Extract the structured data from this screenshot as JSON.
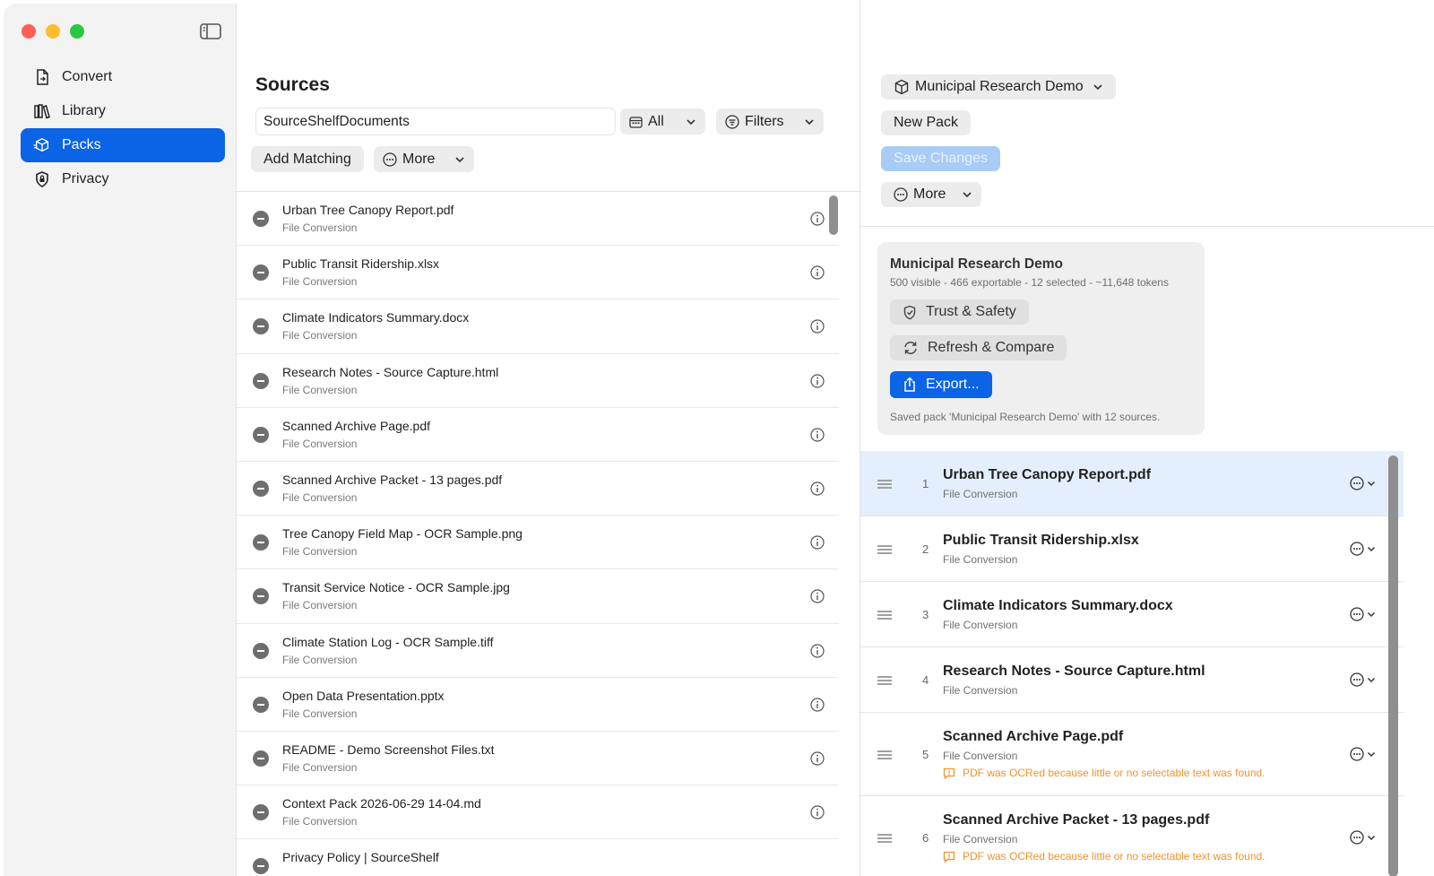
{
  "sidebar": {
    "items": [
      {
        "label": "Convert",
        "icon": "doc-convert-icon"
      },
      {
        "label": "Library",
        "icon": "books-icon"
      },
      {
        "label": "Packs",
        "icon": "cube-icon",
        "active": true
      },
      {
        "label": "Privacy",
        "icon": "shield-lock-icon"
      }
    ]
  },
  "sources": {
    "title": "Sources",
    "search_value": "SourceShelfDocuments",
    "filter_all_label": "All",
    "filters_label": "Filters",
    "add_matching_label": "Add Matching",
    "more_label": "More",
    "items": [
      {
        "name": "Urban Tree Canopy Report.pdf",
        "sub": "File Conversion"
      },
      {
        "name": "Public Transit Ridership.xlsx",
        "sub": "File Conversion"
      },
      {
        "name": "Climate Indicators Summary.docx",
        "sub": "File Conversion"
      },
      {
        "name": "Research Notes - Source Capture.html",
        "sub": "File Conversion"
      },
      {
        "name": "Scanned Archive Page.pdf",
        "sub": "File Conversion"
      },
      {
        "name": "Scanned Archive Packet - 13 pages.pdf",
        "sub": "File Conversion"
      },
      {
        "name": "Tree Canopy Field Map - OCR Sample.png",
        "sub": "File Conversion"
      },
      {
        "name": "Transit Service Notice - OCR Sample.jpg",
        "sub": "File Conversion"
      },
      {
        "name": "Climate Station Log - OCR Sample.tiff",
        "sub": "File Conversion"
      },
      {
        "name": "Open Data Presentation.pptx",
        "sub": "File Conversion"
      },
      {
        "name": "README - Demo Screenshot Files.txt",
        "sub": "File Conversion"
      },
      {
        "name": "Context Pack 2026-06-29 14-04.md",
        "sub": "File Conversion"
      },
      {
        "name": "Privacy Policy | SourceShelf",
        "sub": ""
      }
    ]
  },
  "pack": {
    "selector_label": "Municipal Research Demo",
    "new_pack_label": "New Pack",
    "save_changes_label": "Save Changes",
    "more_label": "More",
    "card": {
      "title": "Municipal Research Demo",
      "subtitle": "500 visible - 466 exportable - 12 selected - ~11,648 tokens",
      "trust_label": "Trust & Safety",
      "refresh_label": "Refresh & Compare",
      "export_label": "Export...",
      "note": "Saved pack 'Municipal Research Demo' with 12 sources."
    },
    "items": [
      {
        "index": "1",
        "title": "Urban Tree Canopy Report.pdf",
        "sub": "File Conversion",
        "warning": ""
      },
      {
        "index": "2",
        "title": "Public Transit Ridership.xlsx",
        "sub": "File Conversion",
        "warning": ""
      },
      {
        "index": "3",
        "title": "Climate Indicators Summary.docx",
        "sub": "File Conversion",
        "warning": ""
      },
      {
        "index": "4",
        "title": "Research Notes - Source Capture.html",
        "sub": "File Conversion",
        "warning": ""
      },
      {
        "index": "5",
        "title": "Scanned Archive Page.pdf",
        "sub": "File Conversion",
        "warning": "PDF was OCRed because little or no selectable text was found."
      },
      {
        "index": "6",
        "title": "Scanned Archive Packet - 13 pages.pdf",
        "sub": "File Conversion",
        "warning": "PDF was OCRed because little or no selectable text was found."
      }
    ]
  },
  "colors": {
    "accent": "#0b63e5",
    "warning": "#f0932b",
    "selected_row": "#e4effd"
  }
}
